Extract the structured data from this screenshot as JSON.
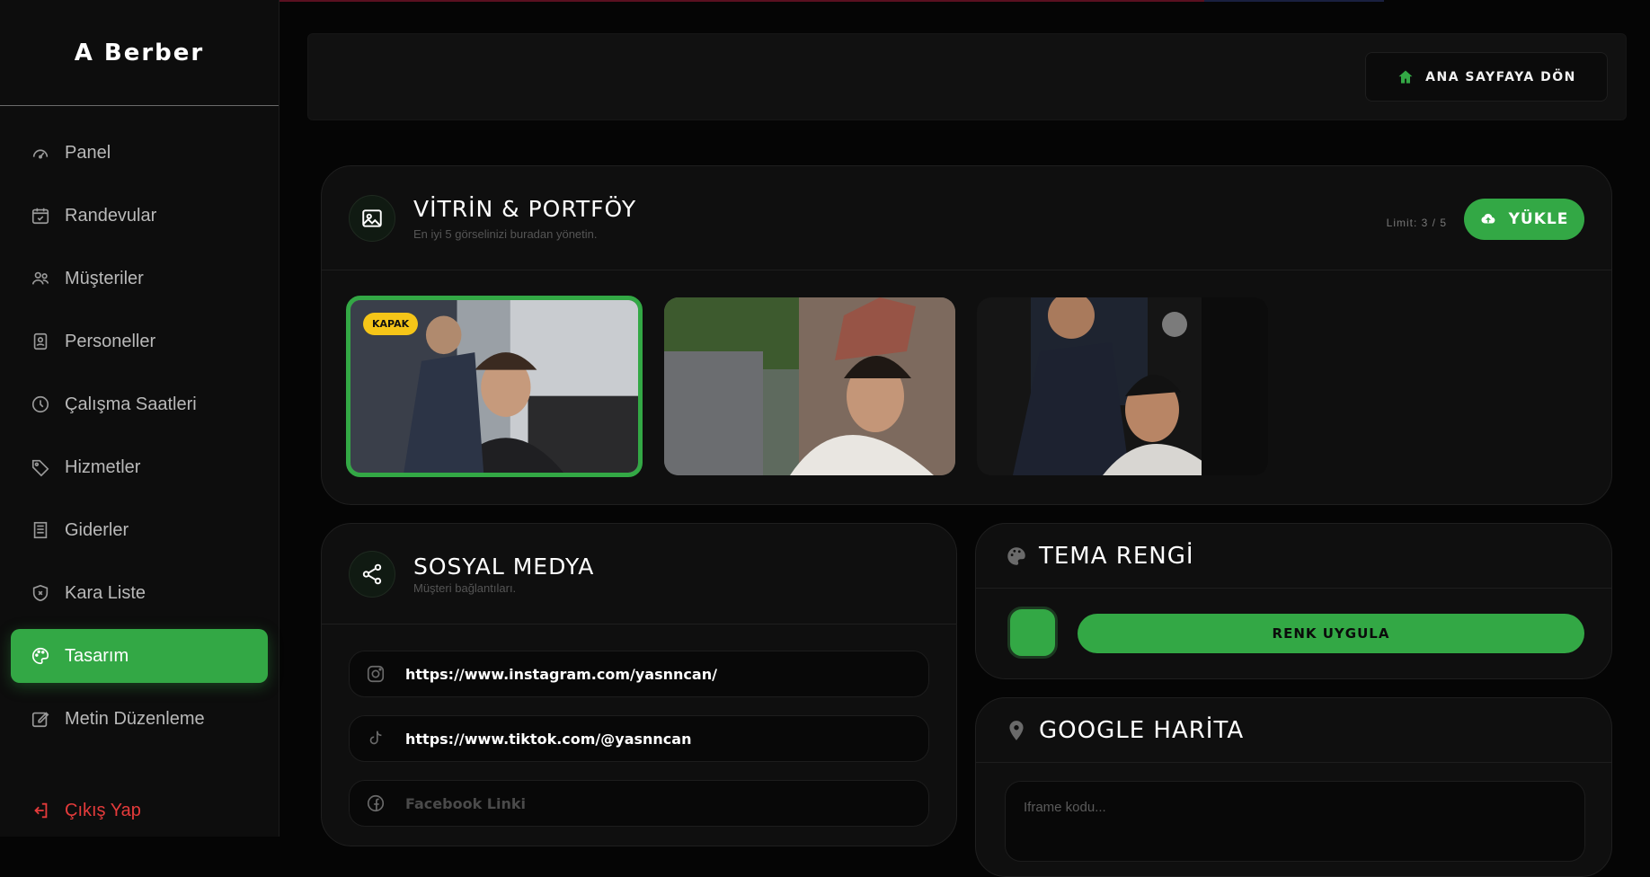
{
  "brand": "A Berber",
  "sidebar": {
    "items": [
      {
        "label": "Panel",
        "icon": "gauge-icon"
      },
      {
        "label": "Randevular",
        "icon": "calendar-check-icon"
      },
      {
        "label": "Müşteriler",
        "icon": "users-icon"
      },
      {
        "label": "Personeller",
        "icon": "id-badge-icon"
      },
      {
        "label": "Çalışma Saatleri",
        "icon": "clock-icon"
      },
      {
        "label": "Hizmetler",
        "icon": "tag-icon"
      },
      {
        "label": "Giderler",
        "icon": "receipt-icon"
      },
      {
        "label": "Kara Liste",
        "icon": "shield-x-icon"
      },
      {
        "label": "Tasarım",
        "icon": "palette-icon",
        "active": true
      },
      {
        "label": "Metin Düzenleme",
        "icon": "edit-icon"
      }
    ],
    "logout": "Çıkış Yap"
  },
  "topbar": {
    "home_label": "ANA SAYFAYA DÖN"
  },
  "vitrin": {
    "title": "VİTRİN & PORTFÖY",
    "subtitle": "En iyi 5 görselinizi buradan yönetin.",
    "limit": "Limit: 3 / 5",
    "upload_label": "YÜKLE",
    "cover_badge": "KAPAK",
    "photo_count": 3
  },
  "sosyal": {
    "title": "SOSYAL MEDYA",
    "subtitle": "Müşteri bağlantıları.",
    "instagram": "https://www.instagram.com/yasnncan/",
    "tiktok": "https://www.tiktok.com/@yasnncan",
    "facebook_placeholder": "Facebook Linki"
  },
  "tema": {
    "title": "TEMA RENGİ",
    "apply_label": "RENK UYGULA",
    "color": "#33a845"
  },
  "harita": {
    "title": "GOOGLE HARİTA",
    "placeholder": "Iframe kodu..."
  }
}
